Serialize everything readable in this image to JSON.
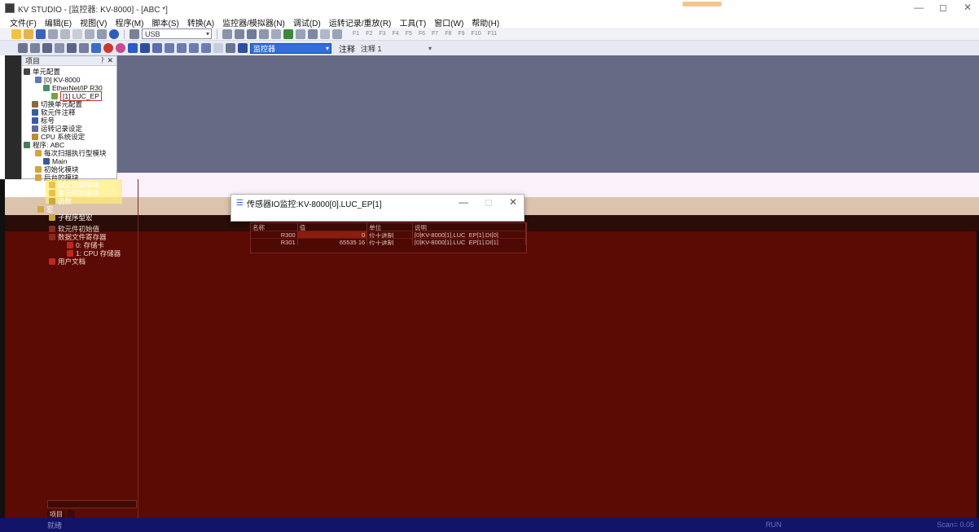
{
  "window": {
    "title": "KV STUDIO - [监控器: KV-8000] - [ABC *]",
    "controls": [
      "—",
      "◻",
      "✕"
    ]
  },
  "menu": [
    "文件(F)",
    "编辑(E)",
    "视图(V)",
    "程序(M)",
    "脚本(S)",
    "转换(A)",
    "监控器/模拟器(N)",
    "调试(D)",
    "运转记录/重放(R)",
    "工具(T)",
    "窗口(W)",
    "帮助(H)"
  ],
  "toolbar": {
    "connection": "USB",
    "mode": "监控器",
    "note_label": "注释",
    "note_value": "注释 1",
    "fkeys": [
      "F1",
      "F2",
      "F3",
      "F4",
      "F5",
      "F6",
      "F7",
      "F8",
      "F9",
      "F10",
      "F11"
    ]
  },
  "project": {
    "header": "项目",
    "pin": "ᚹ ✕",
    "items": [
      "单元配置",
      "[0]  KV-8000",
      "EtherNet/IP   R30",
      "[1]  LUC_EP",
      "切换单元配置",
      "软元件注释",
      "标号",
      "运转记录设定",
      "CPU 系统设定",
      "程序: ABC",
      "每次扫描执行型模块",
      "Main",
      "初始化模块",
      "后台的模块",
      "固定周期模块",
      "单元同步模块",
      "函数",
      "宏",
      "子程序型宏",
      "软元件初始值",
      "数据文件寄存器",
      "0: 存储卡",
      "1: CPU 存储器",
      "用户文档"
    ],
    "tabs": [
      "项目",
      ""
    ]
  },
  "dialog": {
    "title": "传感器IO监控:KV-8000[0].LUC_EP[1]",
    "columns": [
      "名称",
      "值",
      "单位",
      "说明"
    ],
    "rows": [
      {
        "name": "R300",
        "value": "0",
        "unit": "位十进制",
        "desc": "[0]KV-8000[1].LUC_EP[1].DI[0]"
      },
      {
        "name": "R301",
        "value": "65535 16",
        "unit": "位十进制",
        "desc": "[0]KV-8000[1].LUC_EP[1].DI[1]"
      }
    ]
  },
  "status": {
    "left": "就绪",
    "run": "RUN",
    "scan": "Scan= 0.05"
  }
}
